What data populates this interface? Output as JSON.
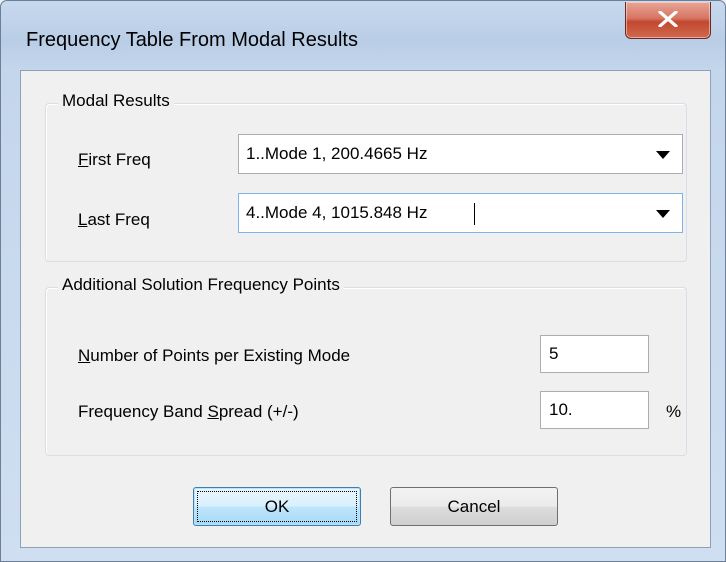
{
  "window": {
    "title": "Frequency Table From Modal Results"
  },
  "modal_results": {
    "legend": "Modal Results",
    "first_freq": {
      "label_access": "F",
      "label_rest": "irst Freq",
      "value": "1..Mode 1, 200.4665 Hz"
    },
    "last_freq": {
      "label_access": "L",
      "label_rest": "ast Freq",
      "value": "4..Mode 4, 1015.848 Hz"
    }
  },
  "additional": {
    "legend": "Additional Solution Frequency Points",
    "points": {
      "label_access": "N",
      "label_rest": "umber of Points per Existing Mode",
      "value": "5"
    },
    "spread": {
      "label_before": "Frequency Band ",
      "label_access": "S",
      "label_after": "pread (+/-)",
      "value": "10.",
      "unit": "%"
    }
  },
  "buttons": {
    "ok": "OK",
    "cancel": "Cancel"
  },
  "icons": {
    "close": "close-icon",
    "dropdown": "chevron-down-icon"
  },
  "colors": {
    "close_button": "#c7432e",
    "default_button_border": "#3c7fb1"
  }
}
